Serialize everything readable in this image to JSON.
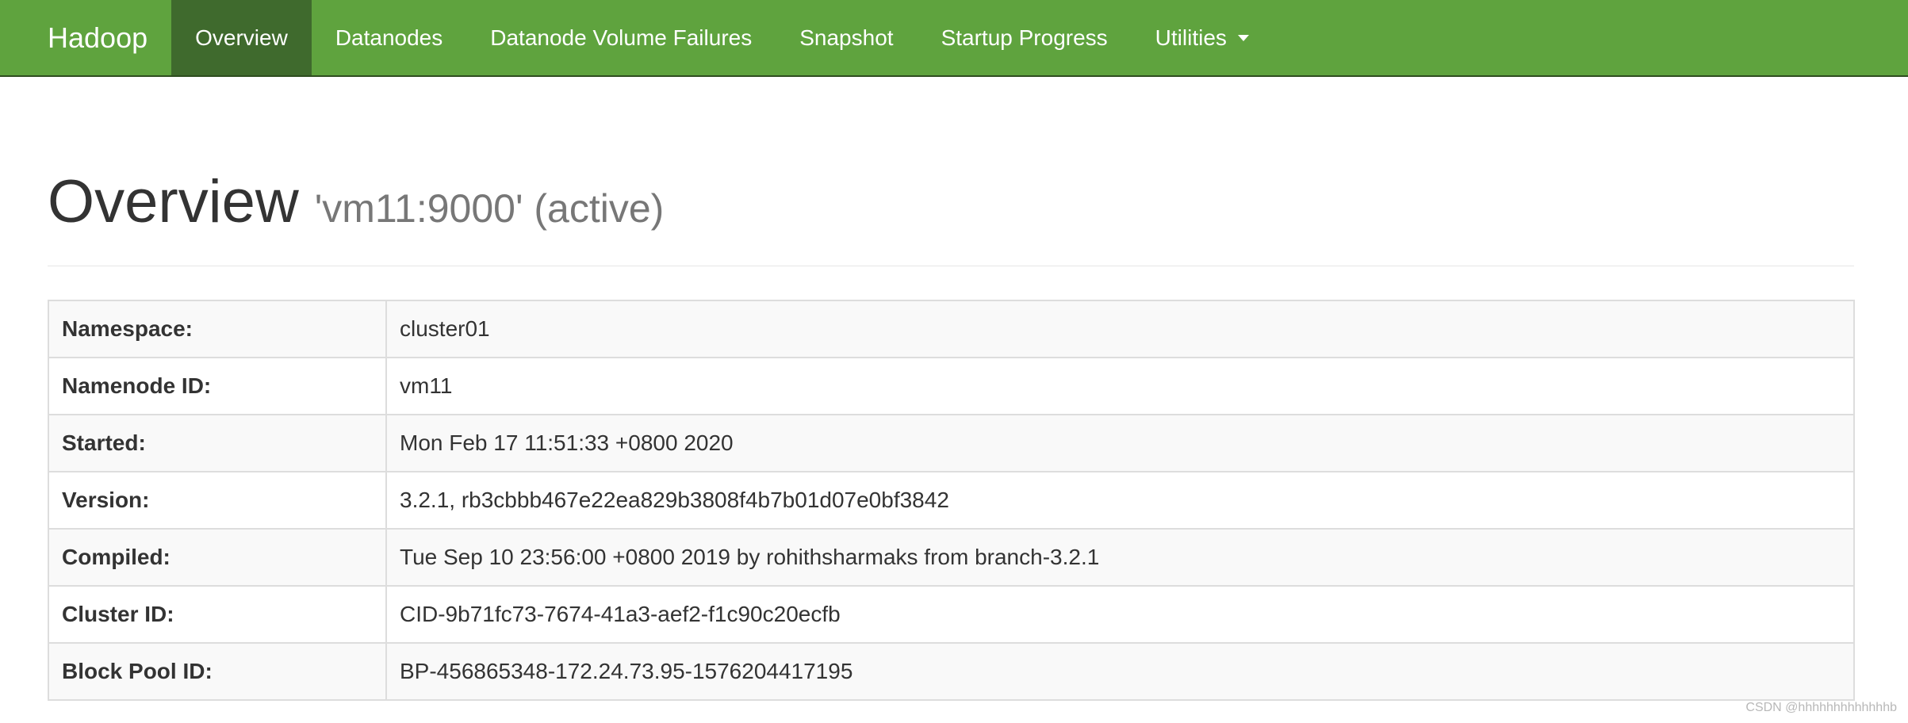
{
  "navbar": {
    "brand": "Hadoop",
    "items": [
      {
        "label": "Overview",
        "active": true
      },
      {
        "label": "Datanodes",
        "active": false
      },
      {
        "label": "Datanode Volume Failures",
        "active": false
      },
      {
        "label": "Snapshot",
        "active": false
      },
      {
        "label": "Startup Progress",
        "active": false
      },
      {
        "label": "Utilities",
        "active": false,
        "dropdown": true
      }
    ]
  },
  "header": {
    "title": "Overview",
    "subtitle": "'vm11:9000' (active)"
  },
  "info": {
    "rows": [
      {
        "label": "Namespace:",
        "value": "cluster01"
      },
      {
        "label": "Namenode ID:",
        "value": "vm11"
      },
      {
        "label": "Started:",
        "value": "Mon Feb 17 11:51:33 +0800 2020"
      },
      {
        "label": "Version:",
        "value": "3.2.1, rb3cbbb467e22ea829b3808f4b7b01d07e0bf3842"
      },
      {
        "label": "Compiled:",
        "value": "Tue Sep 10 23:56:00 +0800 2019 by rohithsharmaks from branch-3.2.1"
      },
      {
        "label": "Cluster ID:",
        "value": "CID-9b71fc73-7674-41a3-aef2-f1c90c20ecfb"
      },
      {
        "label": "Block Pool ID:",
        "value": "BP-456865348-172.24.73.95-1576204417195"
      }
    ]
  },
  "watermark": "CSDN @hhhhhhhhhhhhhb",
  "colors": {
    "navbar_bg": "#5fa33e",
    "navbar_active": "#3f6a2d",
    "text": "#333333",
    "muted": "#777777"
  }
}
